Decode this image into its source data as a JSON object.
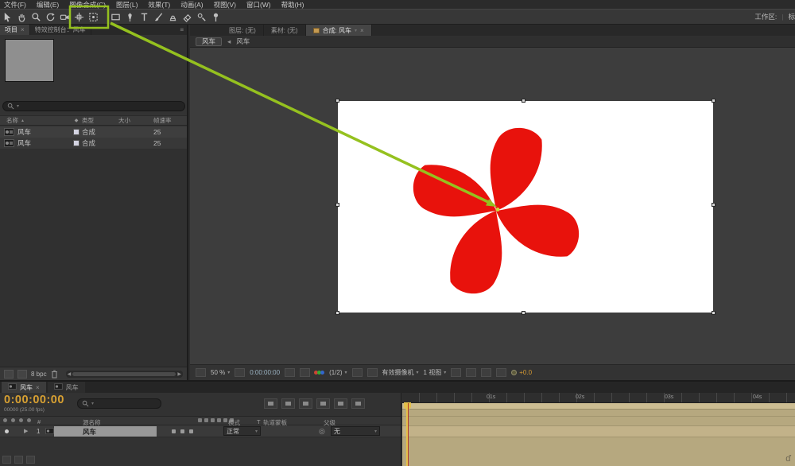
{
  "colors": {
    "accent_red": "#e8120c",
    "annotation_green": "#95c11f",
    "timecode_gold": "#d7a032",
    "timeline_tan": "#b6a87f",
    "exposure_orange": "#d79a33"
  },
  "menu_bar": {
    "items": [
      "文件(F)",
      "编辑(E)",
      "图像合成(C)",
      "图层(L)",
      "效果(T)",
      "动画(A)",
      "视图(V)",
      "窗口(W)",
      "帮助(H)"
    ]
  },
  "toolbar": {
    "tools": [
      "selection-tool",
      "hand-tool",
      "zoom-tool",
      "rotate-tool",
      "camera-tool",
      "axis-mode-tool",
      "pan-behind-anchor-tool",
      "mask-rectangle-tool",
      "pen-tool",
      "text-tool",
      "brush-tool",
      "clone-stamp-tool",
      "eraser-tool",
      "roto-brush-tool",
      "puppet-pin-tool"
    ],
    "workspace_label": "工作区:",
    "workspace_value": "标"
  },
  "project_panel": {
    "tab_project": "项目",
    "tab_effects": "特效控制台：风车",
    "columns": {
      "name": "名称",
      "type": "类型",
      "size": "大小",
      "rate": "帧速率"
    },
    "items": [
      {
        "name": "风车",
        "type": "合成",
        "rate": "25"
      },
      {
        "name": "风车",
        "type": "合成",
        "rate": "25"
      }
    ],
    "footer": {
      "bpc": "8 bpc"
    }
  },
  "comp_panel": {
    "tab_layer": "图层: (无)",
    "tab_footage": "素材: (无)",
    "tab_comp": "合成: 风车",
    "breadcrumb": {
      "parent": "风车",
      "arrow": "◂",
      "current": "风车"
    },
    "statusbar": {
      "zoom": "50 %",
      "timecode": "0:00:00:00",
      "resolution": "(1/2)",
      "camera": "有效摄像机",
      "view": "1 视图",
      "exposure": "+0.0"
    }
  },
  "timeline_panel": {
    "tab1": "风车",
    "tab2": "风车",
    "timecode": "0:00:00:00",
    "frame_info": "00000 (25.00 fps)",
    "columns": {
      "index": "#",
      "source": "源名称",
      "mode": "模式",
      "matte_t": "T",
      "matte": "轨道蒙板",
      "parent": "父级"
    },
    "layer": {
      "index": "1",
      "name": "风车",
      "mode": "正常",
      "parent": "无"
    },
    "ruler_labels": [
      "01s",
      "02s",
      "03s",
      "04s"
    ]
  },
  "watermark": "ď"
}
